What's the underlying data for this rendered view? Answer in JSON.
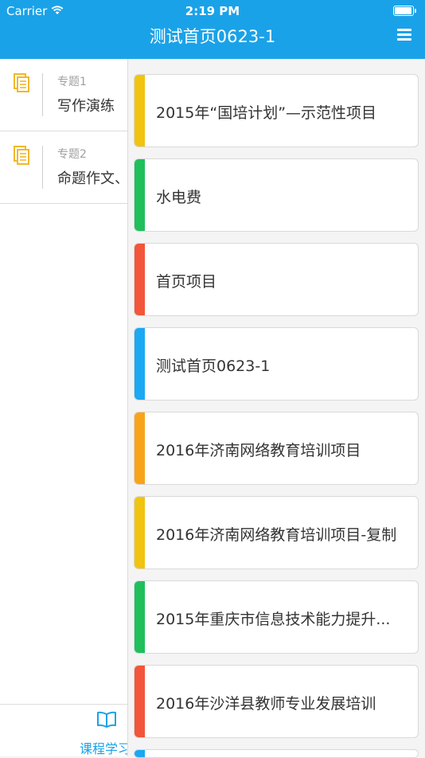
{
  "status_bar": {
    "carrier": "Carrier",
    "time": "2:19 PM"
  },
  "nav": {
    "title": "测试首页0623-1"
  },
  "sidebar": {
    "items": [
      {
        "num": "专题1",
        "name": "写作演练"
      },
      {
        "num": "专题2",
        "name": "命题作文、"
      }
    ],
    "icon_color": "#f2b72b"
  },
  "bottom_tab": {
    "label": "课程学习"
  },
  "cards": [
    {
      "title": "2015年“国培计划”—示范性项目",
      "color": "#f1c40f"
    },
    {
      "title": "水电费",
      "color": "#1fbf5c"
    },
    {
      "title": "首页项目",
      "color": "#f2553a"
    },
    {
      "title": "测试首页0623-1",
      "color": "#1aa9f2"
    },
    {
      "title": "2016年济南网络教育培训项目",
      "color": "#f8a41a"
    },
    {
      "title": "2016年济南网络教育培训项目-复制",
      "color": "#f1c40f"
    },
    {
      "title": "2015年重庆市信息技术能力提升...",
      "color": "#1fbf5c"
    },
    {
      "title": "2016年沙洋县教师专业发展培训",
      "color": "#f2553a"
    },
    {
      "title": "",
      "color": "#1aa9f2"
    }
  ],
  "colors": {
    "primary": "#1aa2e8"
  }
}
